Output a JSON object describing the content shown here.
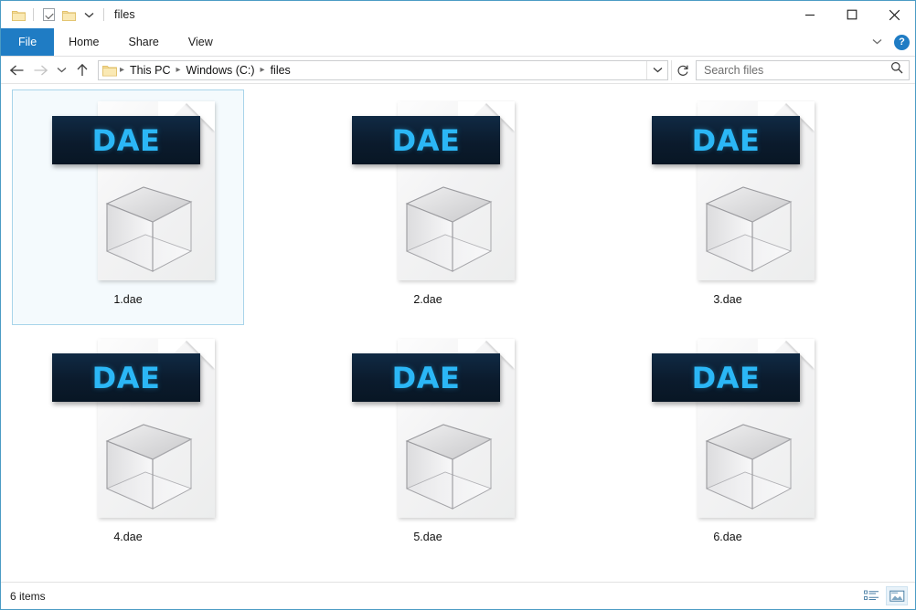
{
  "window": {
    "title": "files",
    "quick_access": [
      {
        "name": "folder-icon",
        "label": "Folder"
      },
      {
        "name": "properties-icon",
        "label": "Properties"
      },
      {
        "name": "new-folder-icon",
        "label": "New folder"
      },
      {
        "name": "chevron-down-icon",
        "label": "Customize Quick Access Toolbar"
      }
    ],
    "controls": {
      "minimize": "Minimize",
      "maximize": "Maximize",
      "close": "Close"
    },
    "border_color": "#4b9bc4"
  },
  "ribbon": {
    "tabs": [
      {
        "label": "File",
        "active": true,
        "accent": "#1f7cc4"
      },
      {
        "label": "Home",
        "active": false
      },
      {
        "label": "Share",
        "active": false
      },
      {
        "label": "View",
        "active": false
      }
    ],
    "collapse_icon": "chevron-down-icon",
    "help_label": "?"
  },
  "address_bar": {
    "back": "Back",
    "forward": "Forward",
    "recent": "Recent locations",
    "up": "Up",
    "breadcrumb": [
      "This PC",
      "Windows (C:)",
      "files"
    ],
    "separator": "›",
    "dropdown_icon": "chevron-down-icon",
    "refresh_icon": "refresh-icon",
    "refresh_glyph": "↻"
  },
  "search": {
    "placeholder": "Search files",
    "value": "",
    "icon": "search-icon"
  },
  "files": [
    {
      "name": "1.dae",
      "ext_label": "DAE",
      "selected": true
    },
    {
      "name": "2.dae",
      "ext_label": "DAE",
      "selected": false
    },
    {
      "name": "3.dae",
      "ext_label": "DAE",
      "selected": false
    },
    {
      "name": "4.dae",
      "ext_label": "DAE",
      "selected": false
    },
    {
      "name": "5.dae",
      "ext_label": "DAE",
      "selected": false
    },
    {
      "name": "6.dae",
      "ext_label": "DAE",
      "selected": false
    }
  ],
  "icon_theme": {
    "banner_bg": "#0b1b2d",
    "banner_text": "#2bb7f6",
    "page_bg": "#f3f3f4"
  },
  "status_bar": {
    "item_count": "6 items",
    "views": [
      {
        "name": "details-view-button",
        "active": false
      },
      {
        "name": "large-icons-view-button",
        "active": true
      }
    ]
  }
}
